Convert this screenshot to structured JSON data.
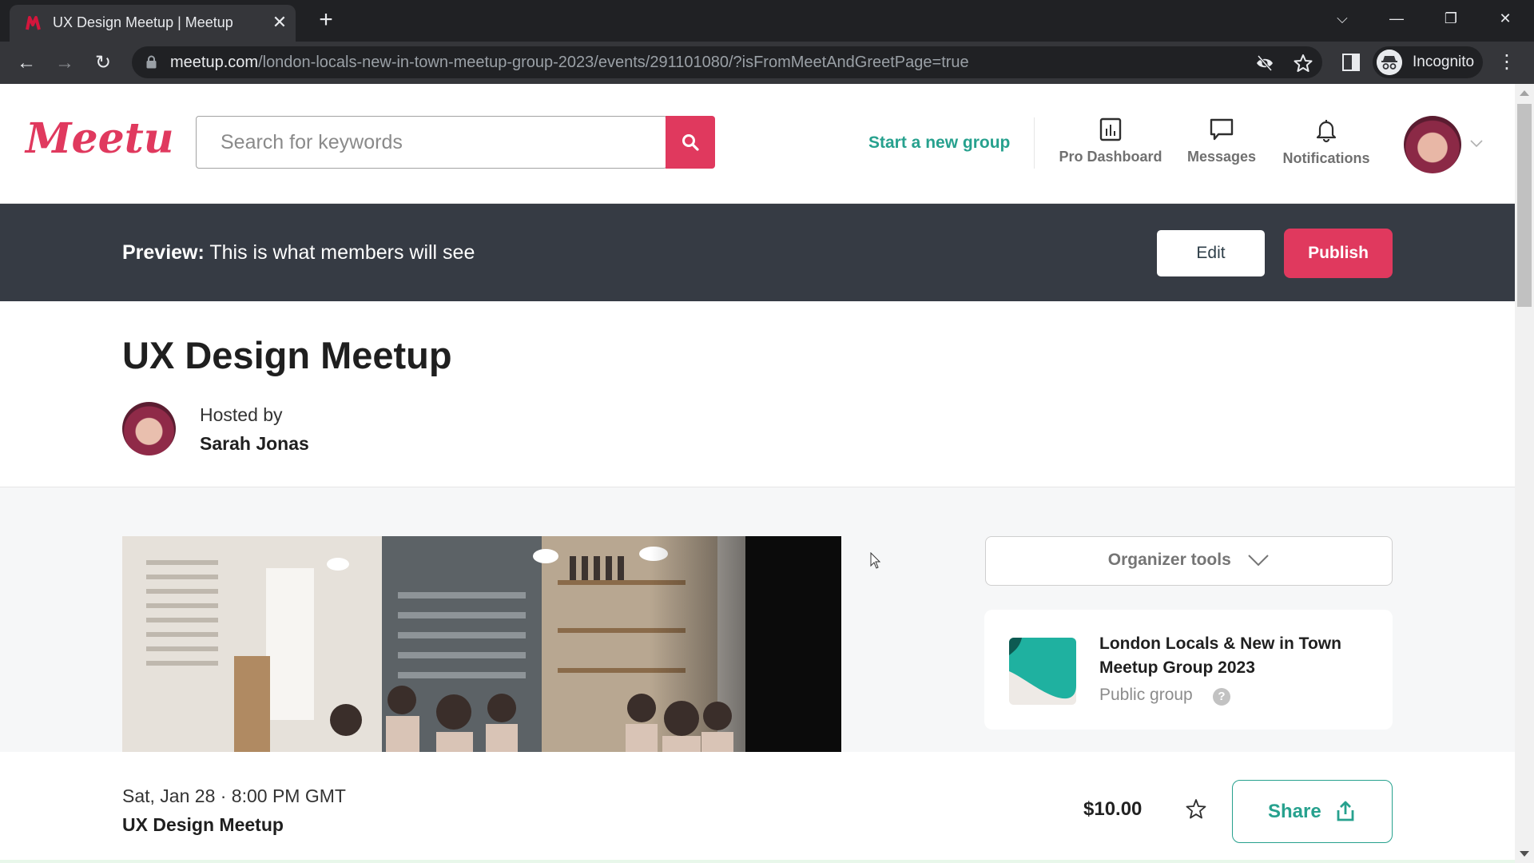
{
  "browser": {
    "tab_title": "UX Design Meetup | Meetup",
    "tab_close": "✕",
    "new_tab": "+",
    "url_host": "meetup.com",
    "url_path": "/london-locals-new-in-town-meetup-group-2023/events/291101080/?isFromMeetAndGreetPage=true",
    "profile_label": "Incognito",
    "window_controls": {
      "tab_search": "⌵",
      "minimize": "—",
      "restore": "❐",
      "close": "✕"
    },
    "nav": {
      "back": "←",
      "forward": "→",
      "reload": "↻",
      "menu": "⋮"
    }
  },
  "header": {
    "logo_text": "Meetup",
    "search_placeholder": "Search for keywords",
    "search_value": "",
    "start_group": "Start a new group",
    "nav_items": [
      {
        "label": "Pro Dashboard",
        "icon": "bar-chart-icon"
      },
      {
        "label": "Messages",
        "icon": "chat-bubble-icon"
      },
      {
        "label": "Notifications",
        "icon": "bell-icon"
      }
    ]
  },
  "preview_banner": {
    "prefix": "Preview:",
    "text": " This is what members will see",
    "edit_label": "Edit",
    "publish_label": "Publish"
  },
  "event": {
    "title": "UX Design Meetup",
    "hosted_by_label": "Hosted by",
    "host_name": "Sarah Jonas",
    "date_time": "Sat, Jan 28 · 8:00 PM GMT",
    "price": "$10.00",
    "share_label": "Share"
  },
  "sidebar": {
    "organizer_tools_label": "Organizer tools",
    "group": {
      "name": "London Locals & New in Town Meetup Group 2023",
      "type": "Public group",
      "help": "?"
    }
  },
  "colors": {
    "brand": "#e0395e",
    "accent_teal": "#27a18e",
    "banner_bg": "#363b44",
    "chrome_dark": "#202124"
  }
}
